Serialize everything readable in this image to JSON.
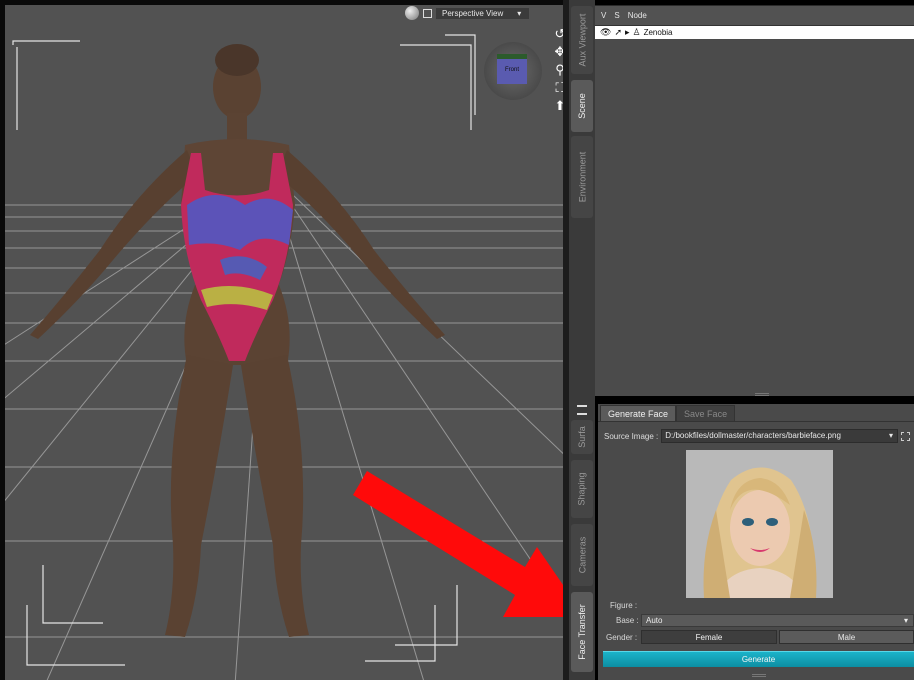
{
  "viewport": {
    "title": "Perspective View",
    "dropdown_arrow": "▾",
    "cube_label": "Front",
    "tools": [
      "orbit-icon",
      "pan-icon",
      "zoom-icon",
      "frame-icon",
      "reset-icon"
    ]
  },
  "side_tabs": {
    "upper": [
      {
        "label": "Aux Viewport",
        "active": false
      },
      {
        "label": "Scene",
        "active": true
      },
      {
        "label": "Environment",
        "active": false
      }
    ],
    "lower": [
      {
        "label": "Surfa",
        "active": false
      },
      {
        "label": "Shaping",
        "active": false
      },
      {
        "label": "Cameras",
        "active": false
      },
      {
        "label": "Face Transfer",
        "active": true
      }
    ]
  },
  "scene": {
    "col_v": "V",
    "col_s": "S",
    "col_node": "Node",
    "rows": [
      {
        "name": "Zenobia"
      }
    ]
  },
  "face_transfer": {
    "tabs": [
      {
        "label": "Generate Face",
        "active": true
      },
      {
        "label": "Save Face",
        "active": false
      }
    ],
    "source_label": "Source Image :",
    "source_value": "D:/bookfiles/dollmaster/characters/barbieface.png",
    "figure_label": "Figure :",
    "base_label": "Base :",
    "base_value": "Auto",
    "gender_label": "Gender :",
    "gender_female": "Female",
    "gender_male": "Male",
    "generate_label": "Generate"
  },
  "colors": {
    "accent": "#15a3b8",
    "arrow": "#ff0a0a",
    "viewport_bg": "#525252"
  }
}
